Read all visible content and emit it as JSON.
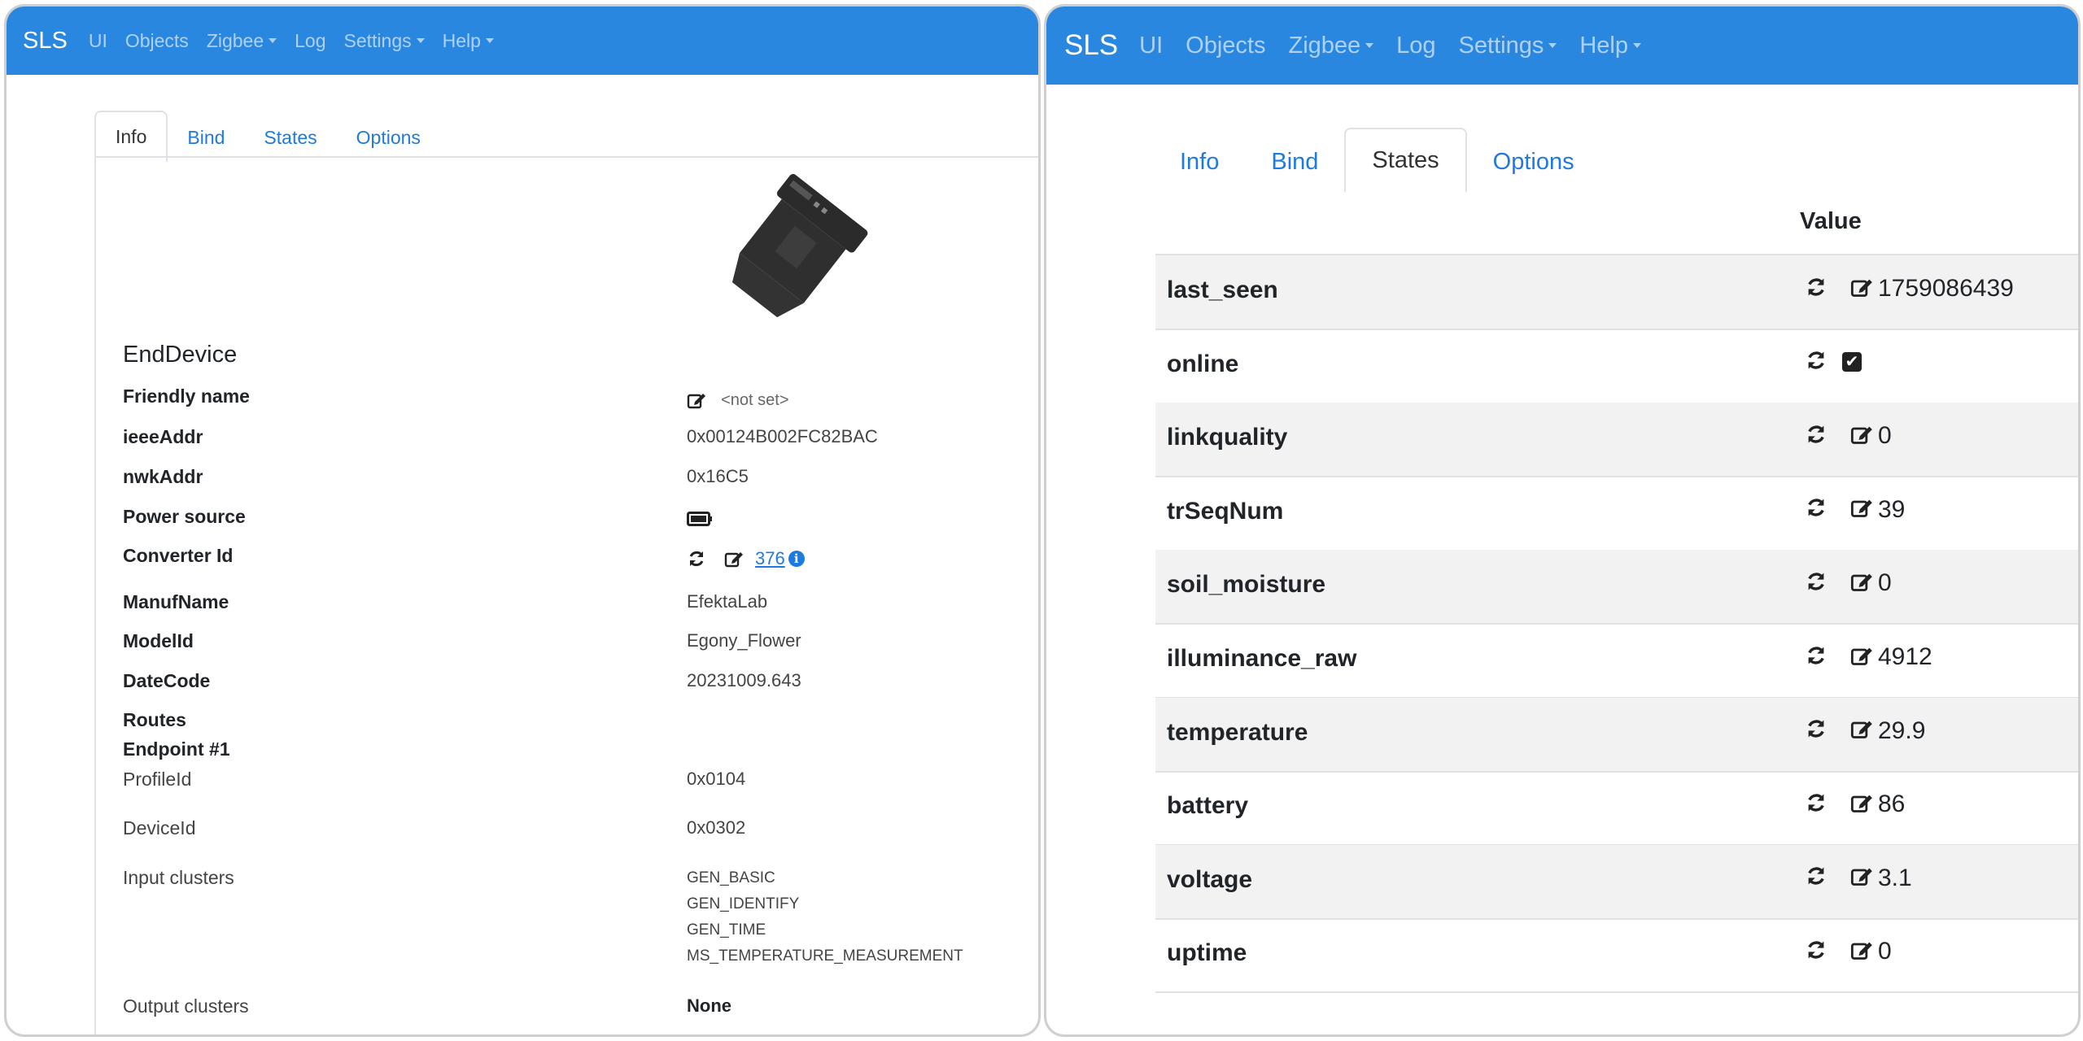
{
  "navbar": {
    "brand": "SLS",
    "items": [
      {
        "label": "UI",
        "dropdown": false
      },
      {
        "label": "Objects",
        "dropdown": false
      },
      {
        "label": "Zigbee",
        "dropdown": true
      },
      {
        "label": "Log",
        "dropdown": false
      },
      {
        "label": "Settings",
        "dropdown": true
      },
      {
        "label": "Help",
        "dropdown": true
      }
    ]
  },
  "tabs": [
    "Info",
    "Bind",
    "States",
    "Options"
  ],
  "left": {
    "active_tab": "Info",
    "device_type": "EndDevice",
    "rows": {
      "friendly_name": {
        "key": "Friendly name",
        "value": "<not set>"
      },
      "ieee_addr": {
        "key": "ieeeAddr",
        "value": "0x00124B002FC82BAC"
      },
      "nwk_addr": {
        "key": "nwkAddr",
        "value": "0x16C5"
      },
      "power_source": {
        "key": "Power source",
        "icon": "battery-icon"
      },
      "converter_id": {
        "key": "Converter Id",
        "value": "376"
      },
      "manuf_name": {
        "key": "ManufName",
        "value": "EfektaLab"
      },
      "model_id": {
        "key": "ModelId",
        "value": "Egony_Flower"
      },
      "date_code": {
        "key": "DateCode",
        "value": "20231009.643"
      },
      "routes": {
        "key": "Routes"
      },
      "endpoint": {
        "key": "Endpoint #1"
      },
      "profile_id": {
        "key": "ProfileId",
        "value": "0x0104"
      },
      "device_id": {
        "key": "DeviceId",
        "value": "0x0302"
      },
      "input_clusters": {
        "key": "Input clusters",
        "values": [
          "GEN_BASIC",
          "GEN_IDENTIFY",
          "GEN_TIME",
          "MS_TEMPERATURE_MEASUREMENT"
        ]
      },
      "output_clusters": {
        "key": "Output clusters",
        "value": "None"
      }
    }
  },
  "right": {
    "active_tab": "States",
    "column_header": "Value",
    "states": [
      {
        "name": "last_seen",
        "value": "1759086439"
      },
      {
        "name": "online",
        "value": "✔"
      },
      {
        "name": "linkquality",
        "value": "0"
      },
      {
        "name": "trSeqNum",
        "value": "39"
      },
      {
        "name": "soil_moisture",
        "value": "0"
      },
      {
        "name": "illuminance_raw",
        "value": "4912"
      },
      {
        "name": "temperature",
        "value": "29.9"
      },
      {
        "name": "battery",
        "value": "86"
      },
      {
        "name": "voltage",
        "value": "3.1"
      },
      {
        "name": "uptime",
        "value": "0"
      }
    ]
  },
  "colors": {
    "navbar": "#2a87df",
    "link": "#1f7ae0",
    "stripe": "#f2f2f2"
  }
}
